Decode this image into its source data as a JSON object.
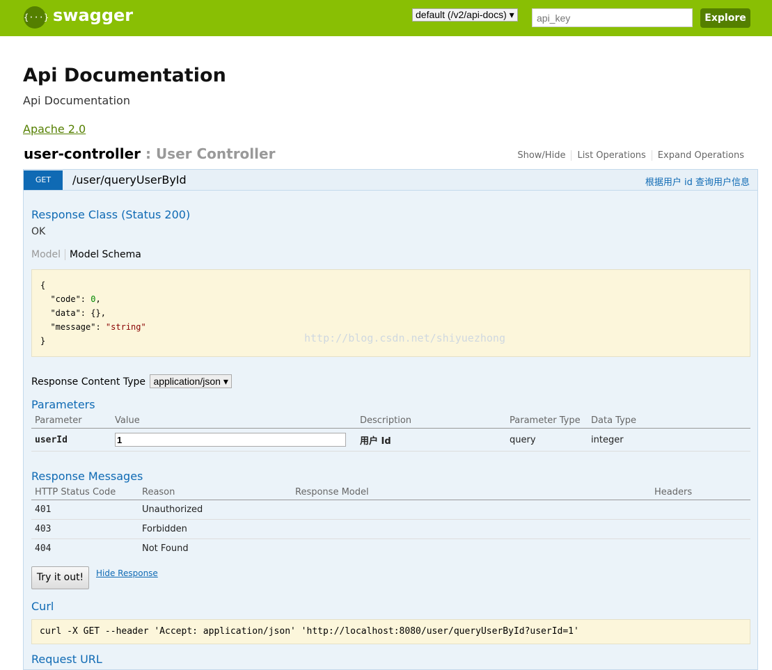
{
  "header": {
    "logo_glyph": "{···}",
    "logo_text": "swagger",
    "spec_select": "default (/v2/api-docs) ▾",
    "api_key_placeholder": "api_key",
    "explore_label": "Explore",
    "bar_color": "#89bf04"
  },
  "info": {
    "title": "Api Documentation",
    "description": "Api Documentation",
    "license": "Apache 2.0"
  },
  "controller": {
    "name": "user-controller",
    "description": " : User Controller",
    "ops": [
      "Show/Hide",
      "List Operations",
      "Expand Operations"
    ]
  },
  "operation": {
    "verb": "GET",
    "path": "/user/queryUserById",
    "summary": "根据用户 id 查询用户信息",
    "response_class_heading": "Response Class (Status 200)",
    "response_class_value": "OK",
    "tab_model": "Model",
    "tab_schema": "Model Schema",
    "schema_lines": [
      {
        "text": "{"
      },
      {
        "key": "  \"code\": ",
        "val": "0",
        "type": "num",
        "tail": ","
      },
      {
        "key": "  \"data\": ",
        "val": "{}",
        "type": "plain",
        "tail": ","
      },
      {
        "key": "  \"message\": ",
        "val": "\"string\"",
        "type": "str",
        "tail": ""
      },
      {
        "text": "}"
      }
    ],
    "watermark": "http://blog.csdn.net/shiyuezhong",
    "response_content_type_label": "Response Content Type",
    "response_content_type": "application/json ▾",
    "parameters_heading": "Parameters",
    "param_headers": [
      "Parameter",
      "Value",
      "Description",
      "Parameter Type",
      "Data Type"
    ],
    "params": [
      {
        "name": "userId",
        "value": "1",
        "description": "用户 Id",
        "param_type": "query",
        "data_type": "integer"
      }
    ],
    "response_messages_heading": "Response Messages",
    "resp_headers": [
      "HTTP Status Code",
      "Reason",
      "Response Model",
      "Headers"
    ],
    "resp_rows": [
      {
        "code": "401",
        "reason": "Unauthorized"
      },
      {
        "code": "403",
        "reason": "Forbidden"
      },
      {
        "code": "404",
        "reason": "Not Found"
      }
    ],
    "try_button": "Try it out!",
    "hide_response": "Hide Response",
    "curl_heading": "Curl",
    "curl_command": "curl -X GET --header 'Accept: application/json' 'http://localhost:8080/user/queryUserById?userId=1'",
    "request_url_heading": "Request URL"
  }
}
